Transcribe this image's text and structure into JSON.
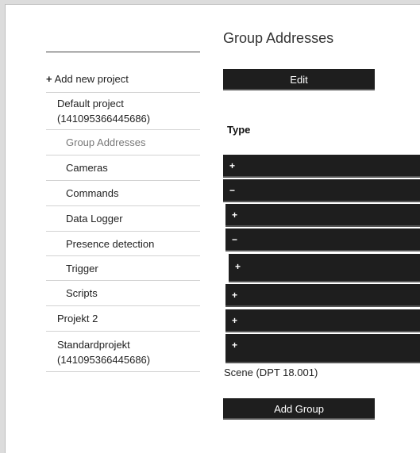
{
  "page": {
    "title": "Group Addresses"
  },
  "sidebar": {
    "add_project": {
      "icon": "+",
      "label": "Add new project"
    },
    "projects": [
      {
        "label": "Default project (141095366445686)"
      },
      {
        "label": "Projekt 2"
      },
      {
        "label": "Standardprojekt (141095366445686)"
      }
    ],
    "subitems": [
      {
        "label": "Group Addresses",
        "active": true
      },
      {
        "label": "Cameras"
      },
      {
        "label": "Commands"
      },
      {
        "label": "Data Logger"
      },
      {
        "label": "Presence detection"
      },
      {
        "label": "Trigger"
      },
      {
        "label": "Scripts"
      }
    ]
  },
  "main": {
    "edit_label": "Edit",
    "type_label": "Type",
    "tree_rows": [
      {
        "toggle": "+"
      },
      {
        "toggle": "−"
      },
      {
        "toggle": "+"
      },
      {
        "toggle": "−"
      },
      {
        "toggle": "+"
      },
      {
        "toggle": "+"
      },
      {
        "toggle": "+"
      },
      {
        "toggle": "+"
      }
    ],
    "selected_type": "Scene (DPT 18.001)",
    "add_group_label": "Add Group"
  },
  "colors": {
    "bar": "#1e1e1e",
    "text": "#222222",
    "divider": "#d2d2d2"
  }
}
